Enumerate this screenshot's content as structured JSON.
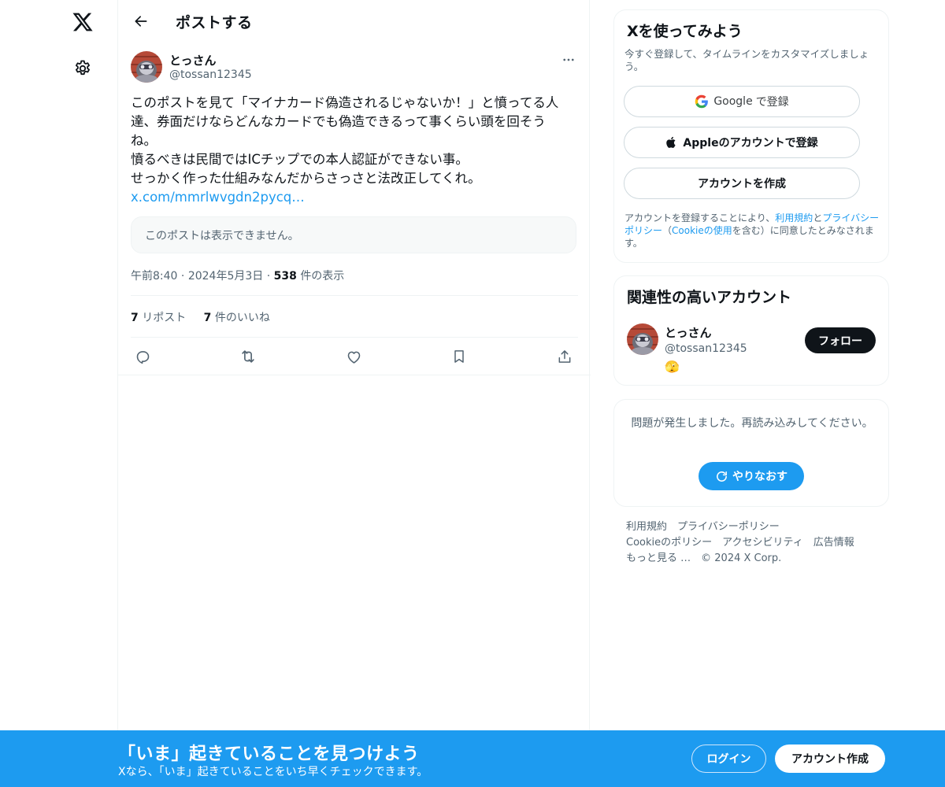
{
  "nav": {
    "logo_icon": "x-logo-icon",
    "settings_icon": "gear-icon"
  },
  "header": {
    "title": "ポストする",
    "back_icon": "arrow-left-icon"
  },
  "post": {
    "author_name": "とっさん",
    "author_handle": "@tossan12345",
    "avatar_icon": "avatar-icon",
    "more_icon": "more-icon",
    "body_lines": [
      "このポストを見て「マイナカード偽造されるじゃないか！」と憤ってる人",
      "達、券面だけならどんなカードでも偽造できるって事くらい頭を回そう",
      "ね。",
      "憤るべきは民間ではICチップでの本人認証ができない事。",
      "せっかく作った仕組みなんだからさっさと法改正してくれ。"
    ],
    "link_text": "x.com/mmrlwvgdn2pycq…",
    "quote_unavailable": "このポストは表示できません。",
    "time": "午前8:40",
    "date": "2024年5月3日",
    "views_count": "538",
    "views_label": "件の表示",
    "separator": "·",
    "reposts_count": "7",
    "reposts_label": "リポスト",
    "likes_count": "7",
    "likes_label": "件のいいね",
    "actions": [
      "reply-icon",
      "repost-icon",
      "like-icon",
      "bookmark-icon",
      "share-icon"
    ]
  },
  "signup_card": {
    "title": "Xを使ってみよう",
    "subtitle": "今すぐ登録して、タイムラインをカスタマイズしましょう。",
    "google_brand": "Google",
    "google_label": "で登録",
    "apple_label": "Appleのアカウントで登録",
    "create_label": "アカウントを作成",
    "legal_prefix": "アカウントを登録することにより、",
    "legal_terms": "利用規約",
    "legal_and": "と",
    "legal_privacy": "プライバシーポリシー",
    "legal_open": "（",
    "legal_cookie": "Cookieの使用",
    "legal_suffix": "を含む）に同意したとみなされます。"
  },
  "related": {
    "title": "関連性の高いアカウント",
    "name": "とっさん",
    "handle": "@tossan12345",
    "emoji": "🫣",
    "follow_label": "フォロー"
  },
  "error_card": {
    "message": "問題が発生しました。再読み込みしてください。",
    "retry_label": "やりなおす",
    "retry_icon": "refresh-icon"
  },
  "footer": {
    "links": [
      "利用規約",
      "プライバシーポリシー",
      "Cookieのポリシー",
      "アクセシビリティ",
      "広告情報",
      "もっと見る …"
    ],
    "copyright": "© 2024 X Corp."
  },
  "bottom_bar": {
    "title": "「いま」起きていることを見つけよう",
    "subtitle": "Xなら、「いま」起きていることをいち早くチェックできます。",
    "login_label": "ログイン",
    "signup_label": "アカウント作成"
  },
  "colors": {
    "accent": "#1d9bf0",
    "text": "#0f1419",
    "muted": "#536471",
    "border": "#eff3f4"
  }
}
